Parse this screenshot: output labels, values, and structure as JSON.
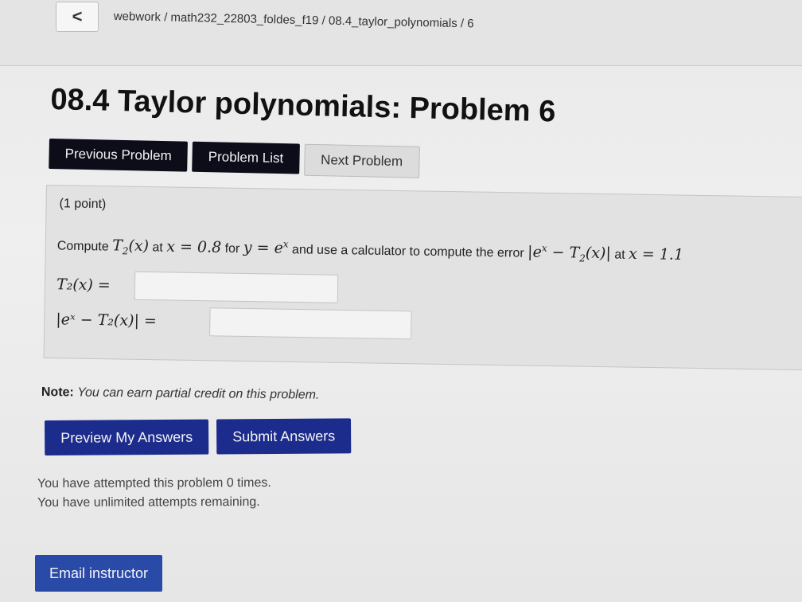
{
  "header": {
    "back_label": "<",
    "breadcrumb": "webwork / math232_22803_foldes_f19 / 08.4_taylor_polynomials / 6"
  },
  "page_title": "08.4 Taylor polynomials: Problem 6",
  "nav": {
    "previous": "Previous Problem",
    "list": "Problem List",
    "next": "Next Problem"
  },
  "problem": {
    "points": "(1 point)",
    "statement": {
      "compute": "Compute",
      "at": "at",
      "x_eq": "x = 0.8",
      "for": "for",
      "func": "y = e",
      "use_calc": "and use a calculator to compute the error",
      "at2": "at",
      "x_eq2": "x = 1.1"
    },
    "answer1_label": "T₂(x) =",
    "answer2_label": "|eˣ − T₂(x)| ="
  },
  "note": {
    "label": "Note:",
    "text": "You can earn partial credit on this problem."
  },
  "actions": {
    "preview": "Preview My Answers",
    "submit": "Submit Answers"
  },
  "attempts": {
    "line1": "You have attempted this problem 0 times.",
    "line2": "You have unlimited attempts remaining."
  },
  "email_label": "Email instructor",
  "colors": {
    "dark_button": "#0d0d1a",
    "action_button": "#1c2c8c",
    "email_button": "#2a4aa8"
  }
}
